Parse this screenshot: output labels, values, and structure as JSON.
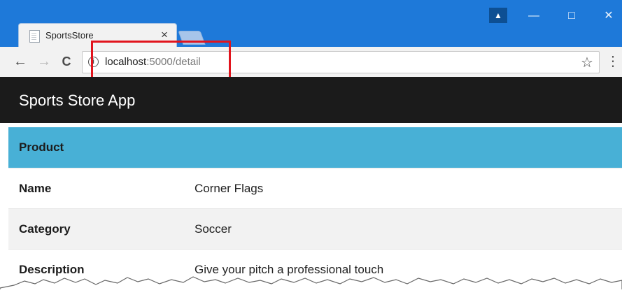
{
  "browser": {
    "tab_title": "SportsStore",
    "tab_close": "×",
    "url_host": "localhost",
    "url_rest": ":5000/detail",
    "nav": {
      "back": "←",
      "forward": "→",
      "reload": "C"
    },
    "star": "☆",
    "menu": "⋮",
    "window": {
      "user": "▲",
      "minimize": "—",
      "maximize": "□",
      "close": "✕"
    }
  },
  "app": {
    "brand": "Sports Store App"
  },
  "table": {
    "header": "Product",
    "rows": [
      {
        "label": "Name",
        "value": "Corner Flags"
      },
      {
        "label": "Category",
        "value": "Soccer"
      },
      {
        "label": "Description",
        "value": "Give your pitch a professional touch"
      }
    ]
  }
}
